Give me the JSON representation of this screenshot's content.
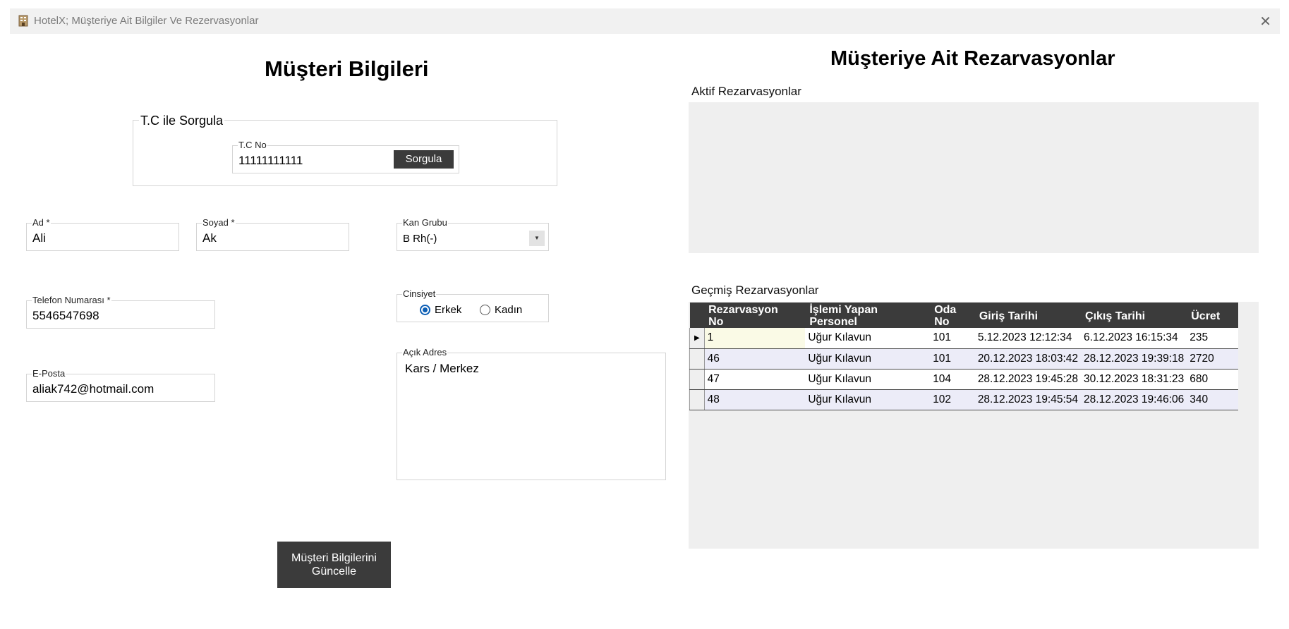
{
  "window": {
    "title": "HotelX; Müşteriye Ait Bilgiler Ve Rezervasyonlar",
    "icon": "hotel-building-icon",
    "close_icon": "close-icon"
  },
  "customer": {
    "heading": "Müşteri Bilgileri",
    "query_group": {
      "legend": "T.C ile Sorgula",
      "tc_label": "T.C No",
      "tc_value": "11111111111",
      "query_button": "Sorgula"
    },
    "first_name": {
      "label": "Ad *",
      "value": "Ali"
    },
    "last_name": {
      "label": "Soyad *",
      "value": "Ak"
    },
    "blood_group": {
      "label": "Kan Grubu",
      "value": "B Rh(-)"
    },
    "phone": {
      "label": "Telefon Numarası *",
      "value": "5546547698"
    },
    "gender": {
      "label": "Cinsiyet",
      "option_male": "Erkek",
      "option_female": "Kadın",
      "selected": "Erkek"
    },
    "email": {
      "label": "E-Posta",
      "value": "aliak742@hotmail.com"
    },
    "address": {
      "label": "Açık Adres",
      "value": "Kars / Merkez"
    },
    "update_button": {
      "line1": "Müşteri Bilgilerini",
      "line2": "Güncelle"
    }
  },
  "reservations": {
    "heading": "Müşteriye Ait Rezarvasyonlar",
    "active_label": "Aktif Rezarvasyonlar",
    "past_label": "Geçmiş Rezarvasyonlar",
    "columns": {
      "reservation_no_1": "Rezarvasyon",
      "reservation_no_2": "No",
      "staff_1": "İşlemi Yapan",
      "staff_2": "Personel",
      "room_1": "Oda",
      "room_2": "No",
      "checkin": "Giriş Tarihi",
      "checkout": "Çıkış Tarihi",
      "fee": "Ücret"
    },
    "rows": [
      {
        "no": "1",
        "staff": "Uğur Kılavun",
        "room": "101",
        "checkin": "5.12.2023 12:12:34",
        "checkout": "6.12.2023 16:15:34",
        "fee": "235",
        "marker": "▶"
      },
      {
        "no": "46",
        "staff": "Uğur Kılavun",
        "room": "101",
        "checkin": "20.12.2023 18:03:42",
        "checkout": "28.12.2023 19:39:18",
        "fee": "2720",
        "marker": ""
      },
      {
        "no": "47",
        "staff": "Uğur Kılavun",
        "room": "104",
        "checkin": "28.12.2023 19:45:28",
        "checkout": "30.12.2023 18:31:23",
        "fee": "680",
        "marker": ""
      },
      {
        "no": "48",
        "staff": "Uğur Kılavun",
        "room": "102",
        "checkin": "28.12.2023 19:45:54",
        "checkout": "28.12.2023 19:46:06",
        "fee": "340",
        "marker": ""
      }
    ]
  },
  "colors": {
    "accent_dark": "#3b3b3b",
    "radio_blue": "#0d5fb5",
    "panel_bg": "#efefef",
    "alt_row": "#ececf8"
  }
}
